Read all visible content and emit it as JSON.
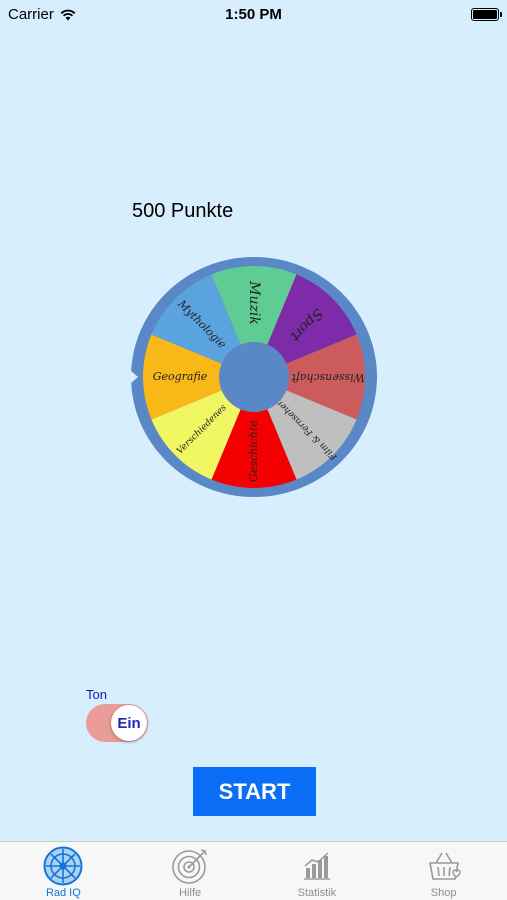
{
  "status_bar": {
    "carrier": "Carrier",
    "time": "1:50 PM"
  },
  "game": {
    "points": "500 Punkte"
  },
  "wheel": {
    "segments": [
      {
        "label": "Muzik",
        "color": "#5fcc93"
      },
      {
        "label": "Sport",
        "color": "#7d2ba9"
      },
      {
        "label": "Wissenschaft",
        "color": "#cc5b5e"
      },
      {
        "label": "Film & Fernsehen",
        "color": "#bfbfbf"
      },
      {
        "label": "Geschichte",
        "color": "#f50000"
      },
      {
        "label": "Verschiedenes",
        "color": "#f1f663"
      },
      {
        "label": "Geografie",
        "color": "#f8b817"
      },
      {
        "label": "Mythologie",
        "color": "#5aa3de"
      }
    ],
    "rim_color": "#5a87c5"
  },
  "sound": {
    "label": "Ton",
    "state": "Ein"
  },
  "start_label": "START",
  "tabs": [
    {
      "label": "Rad IQ",
      "icon": "wheel-icon",
      "active": true
    },
    {
      "label": "Hilfe",
      "icon": "target-icon",
      "active": false
    },
    {
      "label": "Statistik",
      "icon": "bar-chart-icon",
      "active": false
    },
    {
      "label": "Shop",
      "icon": "basket-icon",
      "active": false
    }
  ]
}
